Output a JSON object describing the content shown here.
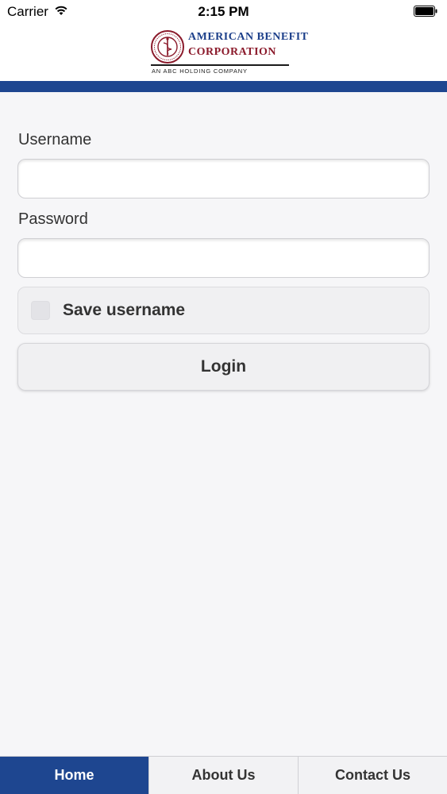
{
  "status_bar": {
    "carrier": "Carrier",
    "time": "2:15 PM",
    "wifi_icon": "wifi-icon",
    "battery_icon": "battery-full-icon"
  },
  "brand": {
    "line1": "AMERICAN BENEFIT",
    "line2": "CORPORATION",
    "tagline": "AN ABC HOLDING COMPANY",
    "seal_icon": "abc-seal-logo",
    "colors": {
      "primary_blue": "#1e4690",
      "brand_red": "#8b1a2b"
    }
  },
  "form": {
    "username_label": "Username",
    "username_value": "",
    "password_label": "Password",
    "password_value": "",
    "save_username_label": "Save username",
    "save_username_checked": false,
    "login_label": "Login"
  },
  "nav": {
    "tabs": [
      {
        "label": "Home",
        "active": true
      },
      {
        "label": "About Us",
        "active": false
      },
      {
        "label": "Contact Us",
        "active": false
      }
    ]
  }
}
